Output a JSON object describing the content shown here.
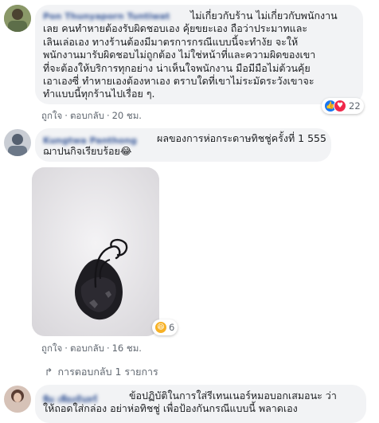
{
  "comments": [
    {
      "author": "Pon Thunyaporn Tuntiwat",
      "text": "ไม่เกี่ยวกับร้าน ไม่เกี่ยวกับพนักงาน\nเลย คนทำหายต้องรับผิดชอบเอง คุ้ยขยะเอง ถือว่าประมาทและ\nเลินเล่อเอง ทางร้านต้องมีมาตรการกรณีแบบนี้จะทำงัย จะให้\nพนักงานมารับผิดชอบไม่ถูกต้อง ไม่ใช่หน้าที่และความผิดของเขา\nที่จะต้องให้บริการทุกอย่าง น่าเห็นใจพนักงาน มือมีมือไม่ต้วนคุ้ย\nเอาเองซี่ ทำหายเองต้องหาเอง ตราบใดที่เขาไม่ระมัดระวังเขาจะ\nทำแบบนี้ทุกร้านไปเรื่อย ๆ.",
      "like_label": "ถูกใจ",
      "reply_label": "ตอบกลับ",
      "time": "20 ชม.",
      "reaction_count": "22",
      "reactions": [
        "like-icon",
        "love-icon"
      ]
    },
    {
      "author": "Kungtwa Panthong",
      "text": "ผลของการห่อกระดาษทิชชู่ครั้งที่ 1 555\nฌาปนกิจเรียบร้อย😂",
      "like_label": "ถูกใจ",
      "reply_label": "ตอบกลับ",
      "time": "16 ชม.",
      "reaction_count": "6",
      "reactions": [
        "haha-icon"
      ],
      "replies_label": "การตอบกลับ 1 รายการ"
    },
    {
      "author": "พิม เพียงจันทร์",
      "text": "ข้อปฏิบัติในการใส่รีเทนเนอร์หมอบอกเสมอนะ ว่า\nให้ถอดใส่กล่อง อย่าห่อทิชชู่ เพื่อป้องกันกรณีแบบนี้ พลาดเอง"
    }
  ],
  "colors": {
    "link": "#385898",
    "bubble": "#f2f3f5",
    "like": "#1877f2",
    "love": "#f0284a",
    "haha": "#f7b125"
  }
}
